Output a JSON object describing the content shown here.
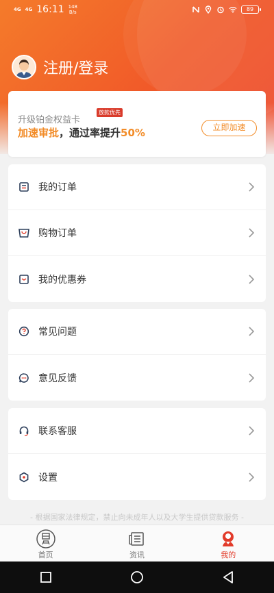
{
  "status_bar": {
    "network_1": "4G",
    "network_2": "4G",
    "time": "16:11",
    "speed": "148\nB/s",
    "battery": "89"
  },
  "user": {
    "login_label": "注册/登录"
  },
  "promo": {
    "subtitle": "升级铂金权益卡",
    "badge": "放款优先",
    "main_prefix": "加速审批",
    "main_middle": "，通过率提升",
    "main_suffix": "50%",
    "button_label": "立即加速"
  },
  "menu_group_1": [
    {
      "label": "我的订单",
      "icon": "order-icon"
    },
    {
      "label": "购物订单",
      "icon": "shopping-bag-icon"
    },
    {
      "label": "我的优惠券",
      "icon": "coupon-icon"
    }
  ],
  "menu_group_2": [
    {
      "label": "常见问题",
      "icon": "question-icon"
    },
    {
      "label": "意见反馈",
      "icon": "feedback-icon"
    }
  ],
  "menu_group_3": [
    {
      "label": "联系客服",
      "icon": "headset-icon"
    },
    {
      "label": "设置",
      "icon": "settings-icon"
    }
  ],
  "notice": "- 根据国家法律规定，禁止向未成年人以及大学生提供贷款服务 -",
  "tabs": [
    {
      "label": "首页",
      "icon": "home-icon",
      "active": false
    },
    {
      "label": "资讯",
      "icon": "news-icon",
      "active": false
    },
    {
      "label": "我的",
      "icon": "profile-icon",
      "active": true
    }
  ],
  "colors": {
    "brand_orange": "#f15a29",
    "accent": "#f28c28",
    "active_tab": "#e23b2a"
  }
}
